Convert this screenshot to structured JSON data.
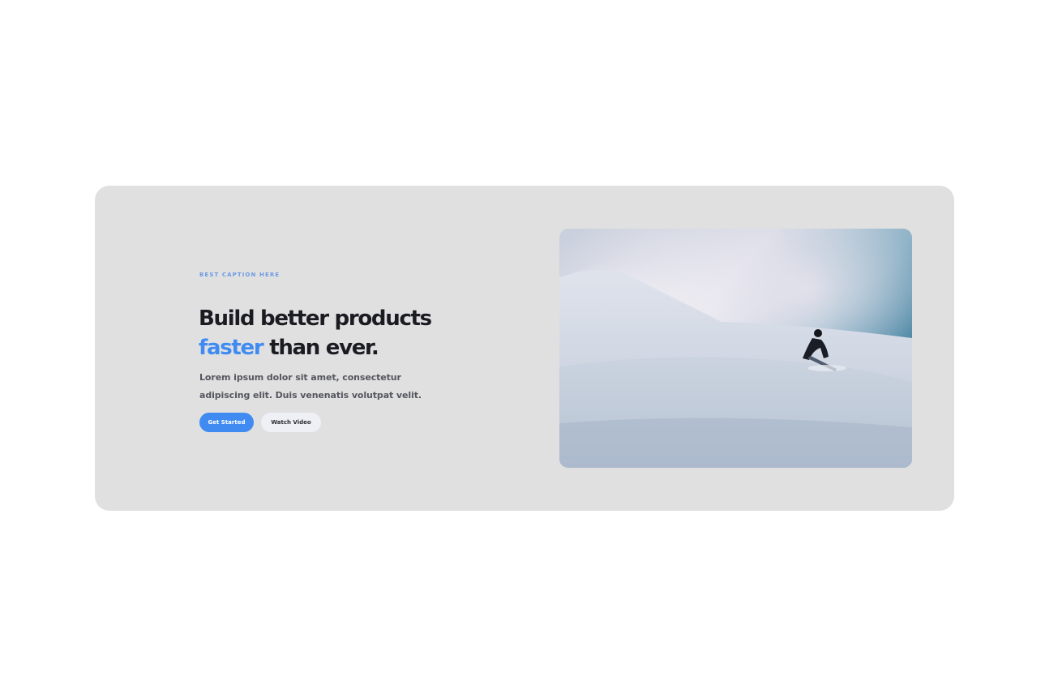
{
  "hero": {
    "caption": "BEST CAPTION HERE",
    "headline_line1": "Build better products",
    "headline_accent": "faster",
    "headline_rest": "than ever.",
    "body": "Lorem ipsum dolor sit amet, consectetur adipiscing elit. Duis venenatis volutpat velit.",
    "primary_button": "Get Started",
    "secondary_button": "Watch Video",
    "image_subject": "snowboarder-in-powder-snow"
  },
  "colors": {
    "page_bg": "#ffffff",
    "card_bg": "#e0e0e1",
    "accent": "#3f8bf2",
    "headline": "#1b1b22",
    "body_text": "#55565e",
    "caption": "#6e9be0"
  }
}
